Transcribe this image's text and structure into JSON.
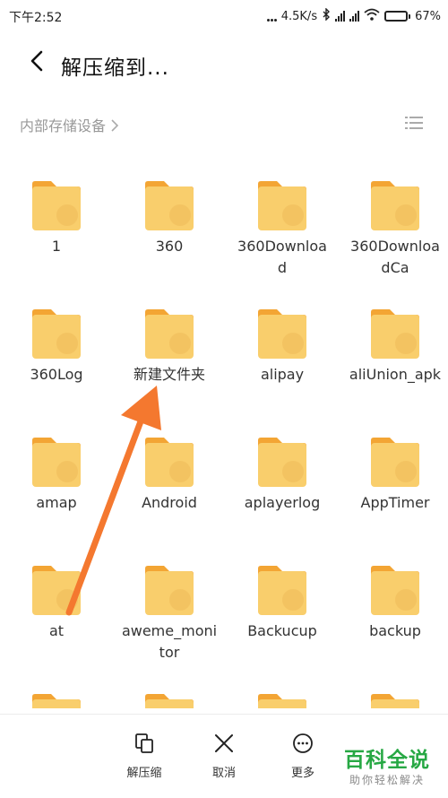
{
  "status": {
    "time": "下午2:52",
    "speed": "4.5K/s",
    "battery_percent": 67,
    "battery_label": "67%"
  },
  "header": {
    "title": "解压缩到..."
  },
  "path": {
    "label": "内部存储设备"
  },
  "folders": [
    "1",
    "360",
    "360Download",
    "360DownloadCa",
    "360Log",
    "新建文件夹",
    "alipay",
    "aliUnion_apk",
    "amap",
    "Android",
    "aplayerlog",
    "AppTimer",
    "at",
    "aweme_monitor",
    "Backucup",
    "backup",
    "",
    "",
    "",
    ""
  ],
  "actions": {
    "decompress": "解压缩",
    "cancel": "取消",
    "more": "更多"
  },
  "watermark": {
    "title": "百科全说",
    "subtitle": "助你轻松解决"
  },
  "colors": {
    "folder_body": "#F9CE6C",
    "folder_tab": "#F3A534",
    "arrow": "#F4782F",
    "watermark_green": "#27A844"
  },
  "icons": {
    "back": "back-arrow-icon",
    "list": "list-view-icon",
    "decompress": "decompress-icon",
    "cancel": "close-icon",
    "more": "more-icon"
  }
}
